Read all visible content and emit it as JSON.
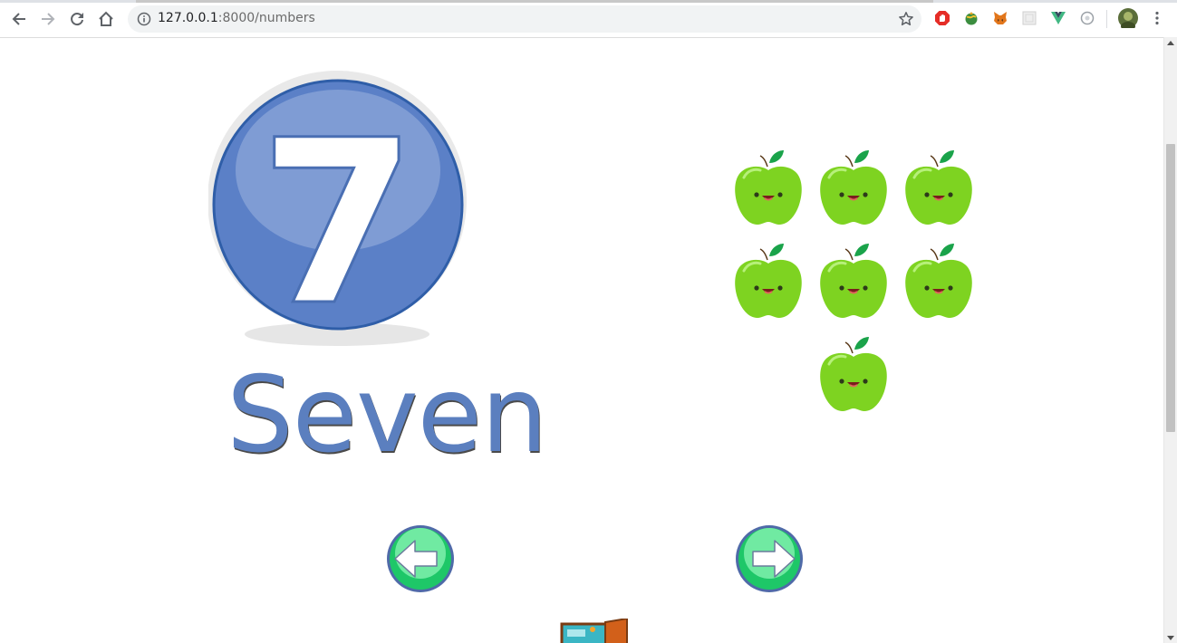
{
  "browser": {
    "url_host": "127.0.0.1",
    "url_rest": ":8000/numbers"
  },
  "lesson": {
    "numeral": "7",
    "word": "Seven",
    "count": 7,
    "counter_object": "apple"
  },
  "icons": {
    "back": "arrow-left-icon",
    "forward": "arrow-right-icon",
    "reload": "reload-icon",
    "home": "home-icon",
    "info": "info-icon",
    "star": "bookmark-star-icon",
    "prev": "prev-arrow-icon",
    "next": "next-arrow-icon"
  },
  "colors": {
    "numeral_circle": "#5b7fc6",
    "word": "#5b7fbf",
    "apple": "#7ed321",
    "nav_button": "#2ecc71"
  }
}
